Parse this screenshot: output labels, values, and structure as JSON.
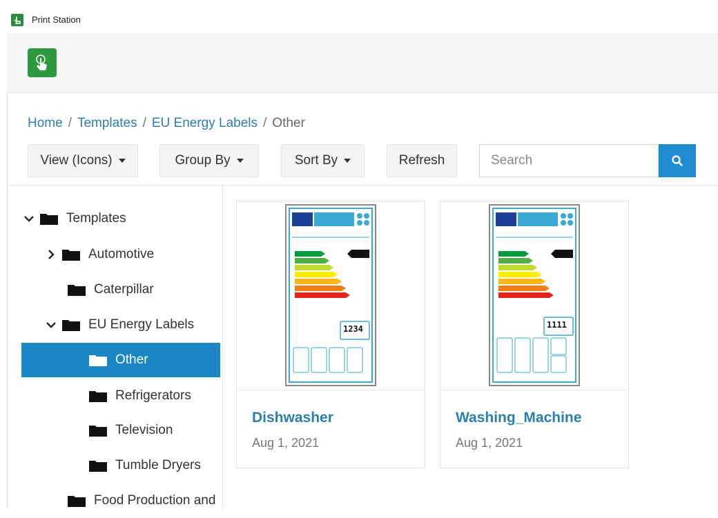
{
  "window": {
    "title": "Print Station"
  },
  "breadcrumb": [
    {
      "label": "Home"
    },
    {
      "label": "Templates"
    },
    {
      "label": "EU Energy Labels"
    },
    {
      "label": "Other"
    }
  ],
  "toolbar": {
    "view_label": "View (Icons)",
    "group_label": "Group By",
    "sort_label": "Sort By",
    "refresh_label": "Refresh",
    "search_placeholder": "Search"
  },
  "tree": [
    {
      "label": "Templates",
      "expanded": true,
      "level": 0
    },
    {
      "label": "Automotive",
      "expanded": false,
      "level": 1
    },
    {
      "label": "Caterpillar",
      "level": 1
    },
    {
      "label": "EU Energy Labels",
      "expanded": true,
      "level": 1
    },
    {
      "label": "Other",
      "selected": true,
      "level": 2
    },
    {
      "label": "Refrigerators",
      "level": 2
    },
    {
      "label": "Television",
      "level": 2
    },
    {
      "label": "Tumble Dryers",
      "level": 2
    },
    {
      "label": "Food Production and",
      "level": 1
    }
  ],
  "cards": [
    {
      "name": "Dishwasher",
      "date": "Aug 1, 2021",
      "label_value": "1234"
    },
    {
      "name": "Washing_Machine",
      "date": "Aug 1, 2021",
      "label_value": "1111"
    }
  ],
  "colors": {
    "accent": "#1a86c5",
    "link": "#2a7fb0",
    "brand_green": "#2e9a3f"
  },
  "icons": [
    "app-icon",
    "search-icon",
    "folder-icon",
    "chevron-down-icon",
    "chevron-right-icon"
  ]
}
